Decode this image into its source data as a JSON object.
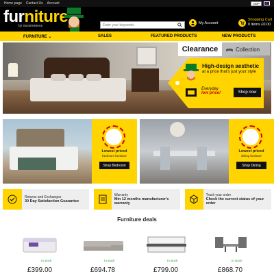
{
  "topbar": {
    "links": [
      "Home page",
      "Contact Us",
      "Account"
    ],
    "currency": "GBP"
  },
  "header": {
    "logo_part1": "fur",
    "logo_part2": "niture",
    "logo_by": "by oxcommerce",
    "search_placeholder": "Enter your keywords",
    "account_label": "My Account",
    "cart_label": "Shopping Cart",
    "cart_amount": "0 items £0.00"
  },
  "nav": {
    "items": [
      "FURNITURE ⌄",
      "SALES",
      "FEATURED PRODUCTS",
      "NEW PRODUCTS"
    ]
  },
  "hero": {
    "tab_clearance": "Clearance",
    "tab_collection": "Collection",
    "headline": "High-design aesthetic",
    "subline": "at a price that's just your style",
    "everyday": "Everyday",
    "low_price": "low price!",
    "shop_button": "Shop now"
  },
  "tiles": [
    {
      "title": "Lowest priced",
      "subtitle": "bedroom furniture",
      "button": "Shop Bedroom",
      "badge": "FURNITURE LOVE"
    },
    {
      "title": "Lowest priced",
      "subtitle": "dining furniture",
      "button": "Shop Dining",
      "badge": "FURNITURE LOVE"
    }
  ],
  "info": [
    {
      "icon": "shield-icon",
      "line1": "Returns and Exchanges",
      "line2": "30 Day Satisfaction Guarantee"
    },
    {
      "icon": "warranty-icon",
      "line1": "Warranty",
      "line2": "Min 12 months manufacturer's warranty"
    },
    {
      "icon": "box-icon",
      "line1": "Track your order",
      "line2": "Check the current status of your order"
    }
  ],
  "deals": {
    "title": "Furniture deals",
    "products": [
      {
        "name": "mattress",
        "stock": "In stock",
        "price": "£399.00"
      },
      {
        "name": "sofa",
        "stock": "In stock",
        "price": "£694.78"
      },
      {
        "name": "trundle-bed",
        "stock": "In stock",
        "price": "£799.00"
      },
      {
        "name": "garden-set",
        "stock": "In stock",
        "price": "£868.70"
      }
    ]
  },
  "colors": {
    "accent": "#ffd400",
    "dark": "#000000",
    "stock": "#2a9d3a",
    "sale_red": "#cc0000"
  }
}
